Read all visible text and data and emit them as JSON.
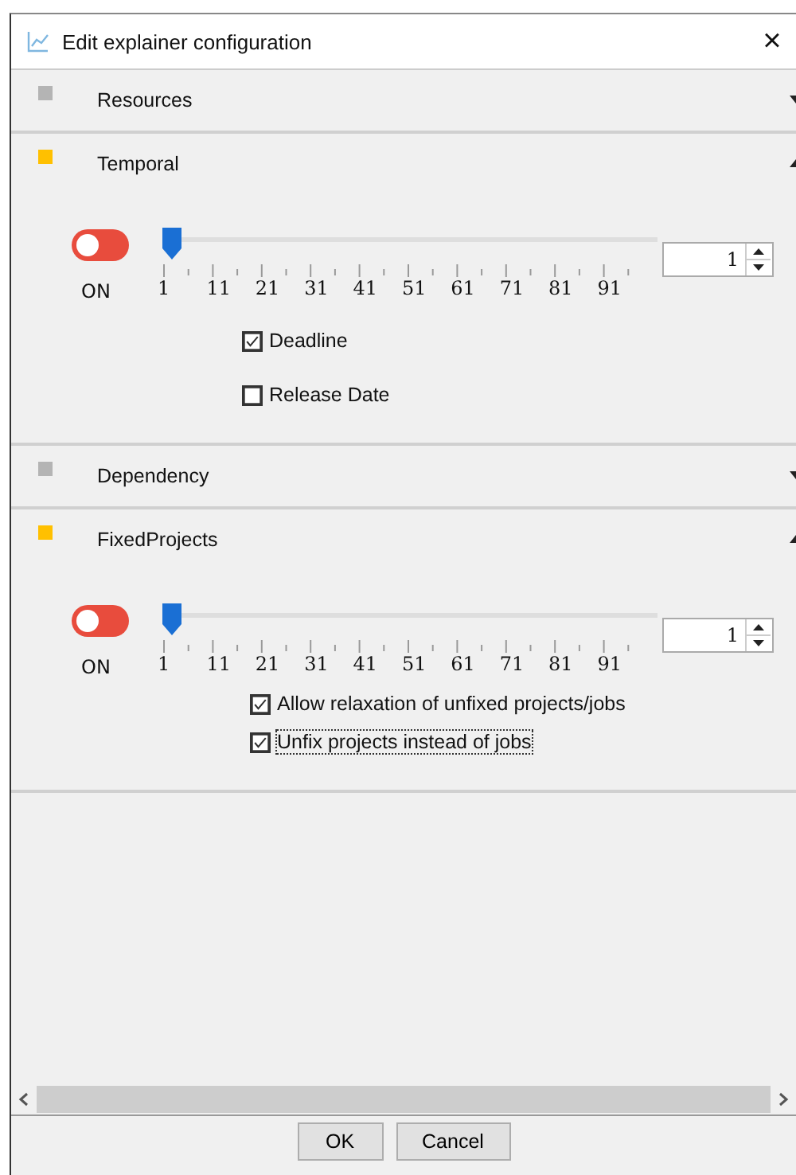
{
  "window": {
    "title": "Edit explainer configuration",
    "close": "×"
  },
  "sections": [
    {
      "name": "Resources",
      "color": "#b4b4b4",
      "expanded": false
    },
    {
      "name": "Temporal",
      "color": "#ffc000",
      "expanded": true,
      "switch": {
        "on": true,
        "label": "ON"
      },
      "slider": {
        "level": 0,
        "labels": [
          "1",
          "11",
          "21",
          "31",
          "41",
          "51",
          "61",
          "71",
          "81",
          "91"
        ]
      },
      "spin": {
        "value": "1"
      },
      "checkboxes": [
        {
          "label": "Deadline",
          "checked": true,
          "focused": false
        },
        {
          "label": "Release Date",
          "checked": false,
          "focused": false
        }
      ]
    },
    {
      "name": "Dependency",
      "color": "#b4b4b4",
      "expanded": false
    },
    {
      "name": "FixedProjects",
      "color": "#ffc000",
      "expanded": true,
      "switch": {
        "on": true,
        "label": "ON"
      },
      "slider": {
        "level": 0,
        "labels": [
          "1",
          "11",
          "21",
          "31",
          "41",
          "51",
          "61",
          "71",
          "81",
          "91"
        ]
      },
      "spin": {
        "value": "1"
      },
      "checkboxes": [
        {
          "label": "Allow relaxation of unfixed projects/jobs",
          "checked": true,
          "focused": false
        },
        {
          "label": "Unfix projects instead of jobs",
          "checked": true,
          "focused": true
        }
      ]
    }
  ],
  "buttons": [
    "OK",
    "Cancel"
  ]
}
